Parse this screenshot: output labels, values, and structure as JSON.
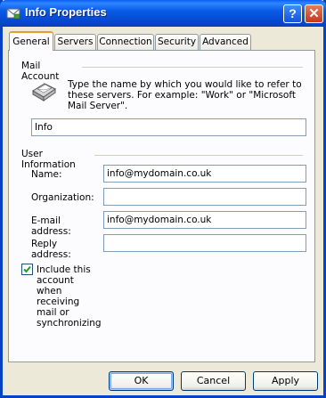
{
  "window": {
    "title": "Info Properties",
    "help_glyph": "?",
    "close_glyph": "✕"
  },
  "tabs": [
    {
      "label": "General",
      "active": true
    },
    {
      "label": "Servers",
      "active": false
    },
    {
      "label": "Connection",
      "active": false
    },
    {
      "label": "Security",
      "active": false
    },
    {
      "label": "Advanced",
      "active": false
    }
  ],
  "mail_account": {
    "group_label": "Mail Account",
    "description": "Type the name by which you would like to refer to these servers.  For example: \"Work\" or \"Microsoft Mail Server\".",
    "account_name": "Info",
    "icon": "mail-account-icon"
  },
  "user_info": {
    "group_label": "User Information",
    "name_label": "Name:",
    "name_value": "info@mydomain.co.uk",
    "organization_label": "Organization:",
    "organization_value": "",
    "email_label": "E-mail address:",
    "email_value": "info@mydomain.co.uk",
    "reply_label": "Reply address:",
    "reply_value": ""
  },
  "include_account": {
    "label": "Include this account when receiving mail or synchronizing",
    "checked": true
  },
  "buttons": {
    "ok": "OK",
    "cancel": "Cancel",
    "apply": "Apply"
  }
}
